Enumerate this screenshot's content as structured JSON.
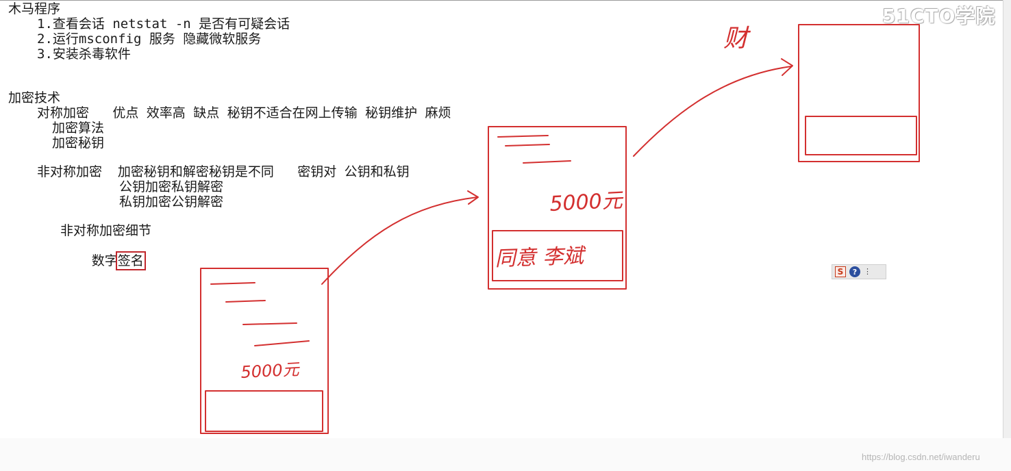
{
  "watermark": "51CTO学院",
  "credit": "https://blog.csdn.net/iwanderu",
  "accent_color": "#d32f2f",
  "notes": {
    "trojan_title": "木马程序",
    "trojan_items": [
      "1.查看会话 netstat -n 是否有可疑会话",
      "2.运行msconfig 服务 隐藏微软服务",
      "3.安装杀毒软件"
    ],
    "crypto_title": "加密技术",
    "symmetric": {
      "line": "对称加密   优点 效率高 缺点 秘钥不适合在网上传输 秘钥维护 麻烦",
      "sub1": "加密算法",
      "sub2": "加密秘钥"
    },
    "asymmetric": {
      "line": "非对称加密  加密秘钥和解密秘钥是不同   密钥对 公钥和私钥",
      "sub1": "公钥加密私钥解密",
      "sub2": "私钥加密公钥解密"
    },
    "detail": "非对称加密细节",
    "digital_prefix": "数字",
    "digital_boxed": "签名"
  },
  "handwriting": {
    "amount_1": "5000元",
    "amount_2": "5000元",
    "approve": "同意 李斌",
    "finance": "财"
  },
  "ime_toolbar": {
    "logo": "S",
    "help": "?",
    "menu": "⋮"
  }
}
